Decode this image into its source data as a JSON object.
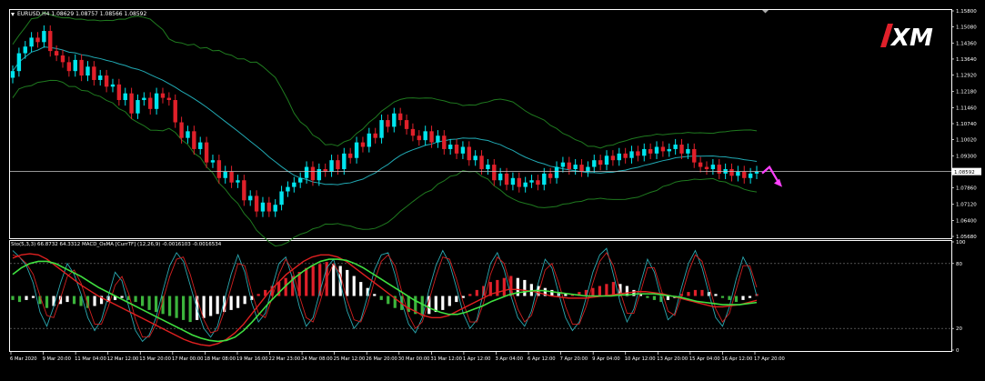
{
  "chart_header": {
    "symbol_tf": "EURUSD,H4",
    "ohlc": "1.08629 1.08757 1.08566 1.08592"
  },
  "sub_header": {
    "stoch": "Sto(5,3,3) 66.8732 64.3312",
    "macd": "MACD_OsMA [CurrTF] (12,26,9) -0.0016103 -0.0016534"
  },
  "logo_text": "XM",
  "colors": {
    "background": "#000000",
    "bull_candle": "#00e5ee",
    "bear_candle": "#e0202a",
    "bollinger": "#1f7a1f",
    "ma": "#21a9b3",
    "arrow": "#ff40ff",
    "osma_green": "#3cb43c",
    "osma_white": "#ffffff",
    "osma_red": "#e0202a",
    "stoch_main": "#2aa8b0",
    "stoch_signal": "#d02020",
    "macd_line": "#e02020",
    "macd_signal": "#40e040"
  },
  "chart_data": [
    {
      "type": "candlestick",
      "title": "EURUSD,H4",
      "ylim": [
        1.0568,
        1.158
      ],
      "y_ticks": [
        "1.15800",
        "1.15080",
        "1.14360",
        "1.13640",
        "1.12920",
        "1.12180",
        "1.11460",
        "1.10740",
        "1.10020",
        "1.09300",
        "1.08592",
        "1.07860",
        "1.07120",
        "1.06400",
        "1.05680"
      ],
      "current_price": "1.08592",
      "x_ticks": [
        "6 Mar 2020",
        "9 Mar 20:00",
        "11 Mar 04:00",
        "12 Mar 12:00",
        "13 Mar 20:00",
        "17 Mar 00:00",
        "18 Mar 08:00",
        "19 Mar 16:00",
        "22 Mar 23:00",
        "24 Mar 08:00",
        "25 Mar 12:00",
        "26 Mar 20:00",
        "30 Mar 00:00",
        "31 Mar 12:00",
        "1 Apr 12:00",
        "3 Apr 04:00",
        "6 Apr 12:00",
        "7 Apr 20:00",
        "9 Apr 04:00",
        "10 Apr 12:00",
        "13 Apr 20:00",
        "15 Apr 04:00",
        "16 Apr 12:00",
        "17 Apr 20:00"
      ],
      "series": [
        {
          "kind": "close",
          "values": [
            1.131,
            1.139,
            1.142,
            1.146,
            1.144,
            1.149,
            1.14,
            1.138,
            1.135,
            1.131,
            1.136,
            1.129,
            1.133,
            1.127,
            1.129,
            1.124,
            1.125,
            1.118,
            1.121,
            1.112,
            1.118,
            1.119,
            1.114,
            1.121,
            1.119,
            1.118,
            1.108,
            1.101,
            1.104,
            1.096,
            1.099,
            1.09,
            1.091,
            1.083,
            1.086,
            1.081,
            1.082,
            1.073,
            1.075,
            1.068,
            1.072,
            1.068,
            1.071,
            1.077,
            1.079,
            1.081,
            1.083,
            1.088,
            1.082,
            1.087,
            1.086,
            1.091,
            1.087,
            1.094,
            1.092,
            1.099,
            1.097,
            1.103,
            1.101,
            1.109,
            1.106,
            1.112,
            1.109,
            1.105,
            1.102,
            1.1,
            1.104,
            1.099,
            1.102,
            1.096,
            1.098,
            1.094,
            1.097,
            1.091,
            1.093,
            1.087,
            1.089,
            1.082,
            1.085,
            1.08,
            1.083,
            1.079,
            1.081,
            1.082,
            1.08,
            1.085,
            1.083,
            1.088,
            1.09,
            1.087,
            1.089,
            1.086,
            1.088,
            1.091,
            1.089,
            1.093,
            1.091,
            1.094,
            1.092,
            1.095,
            1.093,
            1.096,
            1.094,
            1.097,
            1.095,
            1.096,
            1.098,
            1.094,
            1.096,
            1.09,
            1.088,
            1.087,
            1.089,
            1.085,
            1.087,
            1.084,
            1.086,
            1.083,
            1.085,
            1.086
          ]
        },
        {
          "kind": "bollinger_upper"
        },
        {
          "kind": "bollinger_lower"
        },
        {
          "kind": "moving_average"
        }
      ]
    },
    {
      "type": "oscillator",
      "title": "Sto(5,3,3) / MACD_OsMA",
      "ylim": [
        0,
        100
      ],
      "y_ticks": [
        "100",
        "80",
        "20",
        "0"
      ],
      "levels": [
        80,
        20
      ],
      "series": [
        {
          "name": "Sto(5,3,3)",
          "kind": "stoch_main",
          "values": [
            92,
            86,
            78,
            62,
            35,
            22,
            40,
            62,
            80,
            70,
            52,
            30,
            18,
            28,
            50,
            72,
            64,
            40,
            18,
            8,
            14,
            30,
            55,
            78,
            90,
            82,
            60,
            38,
            20,
            12,
            22,
            46,
            70,
            88,
            72,
            44,
            26,
            34,
            58,
            80,
            86,
            66,
            40,
            22,
            30,
            54,
            76,
            84,
            62,
            36,
            20,
            28,
            50,
            74,
            88,
            90,
            70,
            44,
            24,
            16,
            30,
            56,
            78,
            92,
            80,
            58,
            34,
            20,
            28,
            54,
            80,
            90,
            74,
            50,
            30,
            22,
            36,
            62,
            84,
            76,
            52,
            30,
            18,
            26,
            48,
            72,
            88,
            94,
            70,
            44,
            26,
            38,
            62,
            84,
            72,
            48,
            28,
            34,
            58,
            80,
            92,
            76,
            52,
            30,
            22,
            40,
            66,
            86,
            74,
            50
          ]
        },
        {
          "name": "Sto(5,3,3)",
          "kind": "stoch_signal",
          "values": [
            88,
            86,
            80,
            70,
            50,
            32,
            30,
            48,
            68,
            74,
            62,
            42,
            24,
            24,
            40,
            60,
            68,
            52,
            28,
            12,
            12,
            24,
            46,
            68,
            84,
            86,
            70,
            48,
            28,
            16,
            18,
            36,
            58,
            80,
            78,
            54,
            34,
            30,
            48,
            70,
            84,
            74,
            50,
            30,
            26,
            44,
            66,
            80,
            70,
            46,
            28,
            26,
            42,
            64,
            82,
            88,
            78,
            54,
            32,
            20,
            26,
            46,
            68,
            86,
            84,
            66,
            44,
            26,
            26,
            44,
            70,
            86,
            80,
            58,
            38,
            26,
            32,
            52,
            74,
            80,
            62,
            40,
            24,
            24,
            40,
            62,
            82,
            90,
            78,
            54,
            34,
            34,
            54,
            76,
            76,
            56,
            36,
            32,
            50,
            72,
            88,
            82,
            60,
            38,
            26,
            34,
            56,
            78,
            78,
            58
          ]
        },
        {
          "name": "MACD_OsMA",
          "kind": "osma",
          "values": [
            -2,
            -3,
            -2,
            -1,
            -4,
            -6,
            -5,
            -4,
            -3,
            -4,
            -5,
            -6,
            -5,
            -4,
            -3,
            -2,
            -1,
            -2,
            -3,
            -5,
            -7,
            -8,
            -9,
            -10,
            -11,
            -12,
            -13,
            -12,
            -11,
            -10,
            -9,
            -8,
            -7,
            -6,
            -4,
            -2,
            1,
            3,
            5,
            7,
            9,
            10,
            12,
            14,
            15,
            16,
            17,
            16,
            15,
            13,
            10,
            7,
            4,
            1,
            -2,
            -4,
            -6,
            -7,
            -8,
            -9,
            -10,
            -9,
            -8,
            -7,
            -5,
            -3,
            -1,
            1,
            3,
            5,
            7,
            8,
            9,
            10,
            9,
            8,
            6,
            5,
            4,
            3,
            2,
            1,
            1,
            2,
            3,
            4,
            5,
            6,
            7,
            6,
            5,
            3,
            1,
            -1,
            -2,
            -3,
            -2,
            -1,
            1,
            2,
            3,
            3,
            2,
            1,
            -1,
            -2,
            -3,
            -2,
            -1,
            1
          ]
        },
        {
          "name": "MACD_OsMA",
          "kind": "macd_line",
          "values": [
            85,
            88,
            89,
            88,
            84,
            78,
            72,
            66,
            60,
            55,
            50,
            46,
            42,
            38,
            34,
            30,
            26,
            22,
            18,
            14,
            10,
            7,
            5,
            4,
            6,
            10,
            16,
            24,
            34,
            44,
            54,
            62,
            70,
            76,
            82,
            86,
            88,
            88,
            86,
            82,
            76,
            70,
            64,
            58,
            52,
            46,
            40,
            36,
            32,
            30,
            30,
            32,
            36,
            40,
            44,
            48,
            52,
            54,
            56,
            56,
            55,
            54,
            52,
            50,
            49,
            48,
            48,
            48,
            49,
            50,
            51,
            52,
            53,
            54,
            54,
            53,
            52,
            50,
            48,
            46,
            44,
            42,
            40,
            40,
            41,
            42,
            44,
            46
          ]
        },
        {
          "name": "MACD_OsMA",
          "kind": "macd_signal",
          "values": [
            70,
            76,
            80,
            82,
            82,
            80,
            76,
            72,
            68,
            63,
            58,
            54,
            50,
            46,
            42,
            38,
            34,
            30,
            26,
            22,
            18,
            14,
            11,
            9,
            8,
            9,
            12,
            18,
            26,
            35,
            44,
            52,
            60,
            67,
            73,
            78,
            82,
            84,
            84,
            83,
            80,
            76,
            71,
            66,
            61,
            56,
            51,
            46,
            42,
            38,
            35,
            33,
            33,
            35,
            38,
            41,
            45,
            48,
            51,
            53,
            54,
            55,
            55,
            54,
            53,
            52,
            51,
            50,
            50,
            50,
            50,
            51,
            51,
            52,
            52,
            52,
            51,
            50,
            49,
            47,
            45,
            44,
            43,
            42,
            42,
            42,
            43,
            44
          ]
        }
      ]
    }
  ]
}
